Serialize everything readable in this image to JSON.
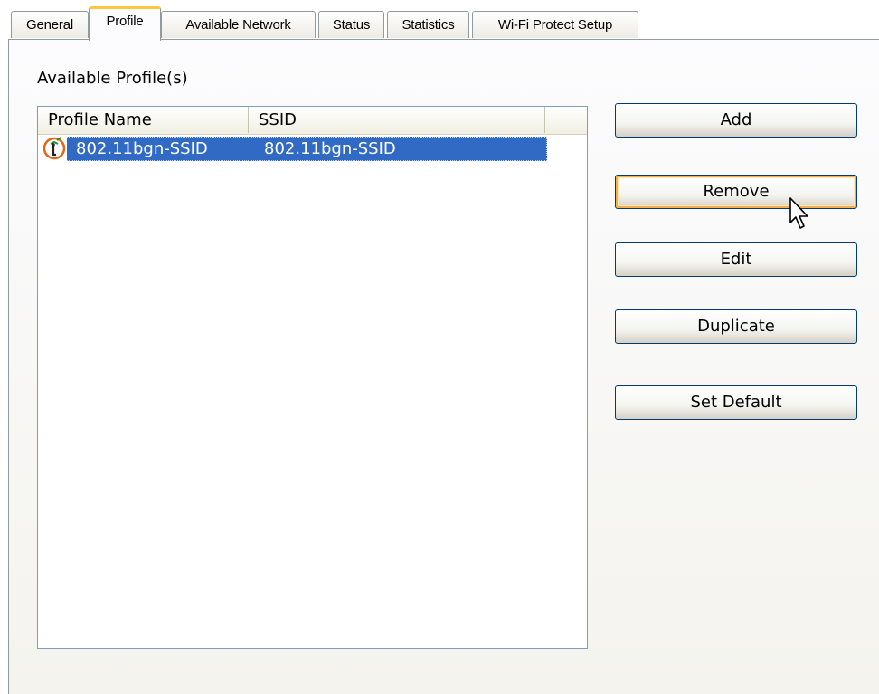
{
  "tabs": [
    {
      "label": "General",
      "active": false
    },
    {
      "label": "Profile",
      "active": true
    },
    {
      "label": "Available Network",
      "active": false
    },
    {
      "label": "Status",
      "active": false
    },
    {
      "label": "Statistics",
      "active": false
    },
    {
      "label": "Wi-Fi Protect Setup",
      "active": false
    }
  ],
  "profiles": {
    "group_title": "Available Profile(s)",
    "columns": [
      "Profile Name",
      "SSID"
    ],
    "rows": [
      {
        "profile_name": "802.11bgn-SSID",
        "ssid": "802.11bgn-SSID",
        "icon": "wireless-profile-icon",
        "selected": true
      }
    ]
  },
  "buttons": {
    "add": "Add",
    "remove": "Remove",
    "edit": "Edit",
    "duplicate": "Duplicate",
    "set_default": "Set Default"
  },
  "colors": {
    "selection": "#316ac5",
    "active_tab_accent": "#ffc83c",
    "button_border": "#003c74",
    "hover_highlight": "#f9b04a"
  },
  "cursor": "arrow-cursor-icon"
}
